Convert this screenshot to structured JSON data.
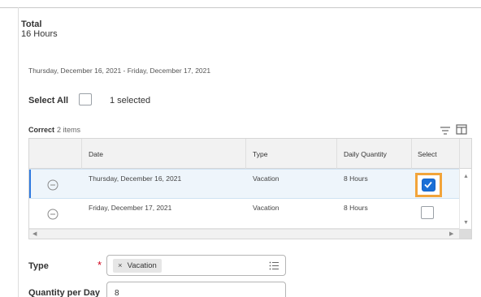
{
  "summary": {
    "total_label": "Total",
    "total_value": "16 Hours",
    "date_range": "Thursday, December 16, 2021 - Friday, December 17, 2021"
  },
  "selection": {
    "select_all_label": "Select All",
    "selected_count": "1 selected"
  },
  "grid": {
    "title": "Correct",
    "item_count": "2 items",
    "columns": [
      "Date",
      "Type",
      "Daily Quantity",
      "Select"
    ],
    "rows": [
      {
        "date": "Thursday, December 16, 2021",
        "type": "Vacation",
        "daily_quantity": "8 Hours",
        "selected": true
      },
      {
        "date": "Friday, December 17, 2021",
        "type": "Vacation",
        "daily_quantity": "8 Hours",
        "selected": false
      }
    ]
  },
  "form": {
    "type_label": "Type",
    "required_marker": "*",
    "type_chip": "Vacation",
    "chip_remove": "×",
    "quantity_label": "Quantity per Day",
    "quantity_value": "8"
  },
  "colors": {
    "accent": "#2f7ae0",
    "checkbox_highlight": "#f2a43a",
    "required": "#d0021b"
  },
  "icons": [
    "filter-icon",
    "columns-icon",
    "minus-circle-icon",
    "checkbox-checked-icon",
    "list-icon"
  ]
}
